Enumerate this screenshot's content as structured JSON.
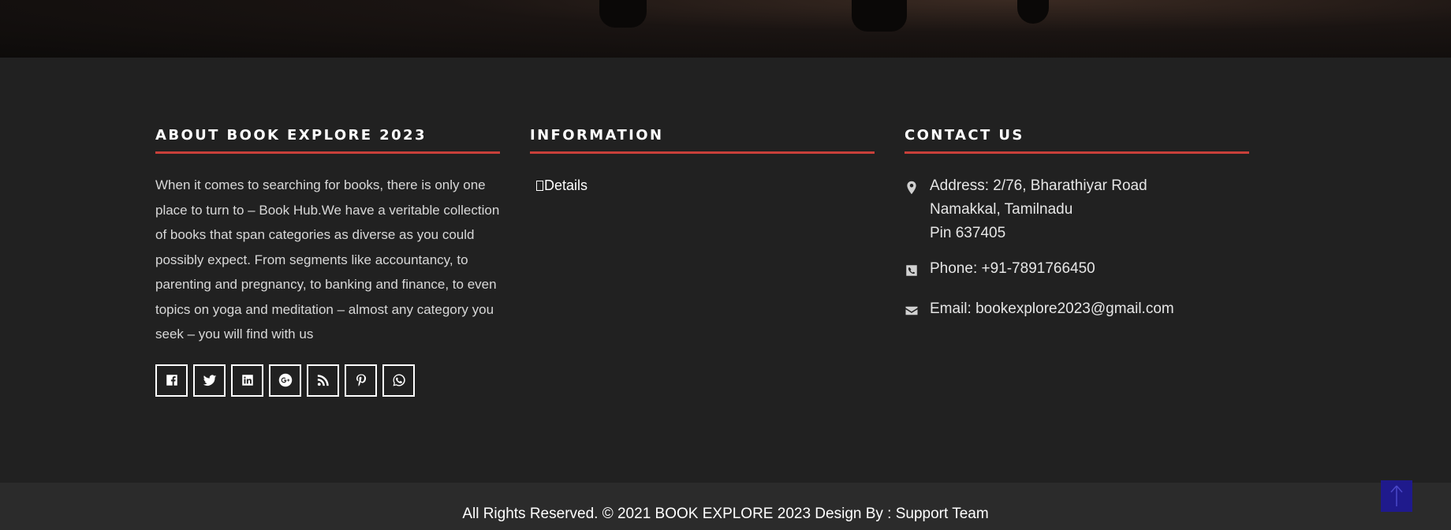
{
  "about": {
    "title": "ABOUT BOOK EXPLORE 2023",
    "text": "When it comes to searching for books, there is only one place to turn to – Book Hub.We have a veritable collection of books that span categories as diverse as you could possibly expect. From segments like accountancy, to parenting and pregnancy, to banking and finance, to even topics on yoga and meditation – almost any category you seek – you will find with us",
    "socials": [
      "facebook-icon",
      "twitter-icon",
      "linkedin-icon",
      "google-plus-icon",
      "rss-icon",
      "pinterest-icon",
      "whatsapp-icon"
    ]
  },
  "information": {
    "title": "INFORMATION",
    "links": [
      {
        "label": "Details"
      }
    ]
  },
  "contact": {
    "title": "CONTACT US",
    "address_line1": "Address: 2/76, Bharathiyar Road",
    "address_line2": "Namakkal, Tamilnadu",
    "address_line3": "Pin 637405",
    "phone": "Phone: +91-7891766450",
    "email": "Email: bookexplore2023@gmail.com"
  },
  "footer": {
    "copyright": "All Rights Reserved. © 2021 BOOK EXPLORE 2023 Design By : Support Team"
  },
  "colors": {
    "accent": "#c9403a",
    "background": "#212121",
    "bottom_bar": "#2b2b2b",
    "scroll_top": "#1f1a8c"
  }
}
